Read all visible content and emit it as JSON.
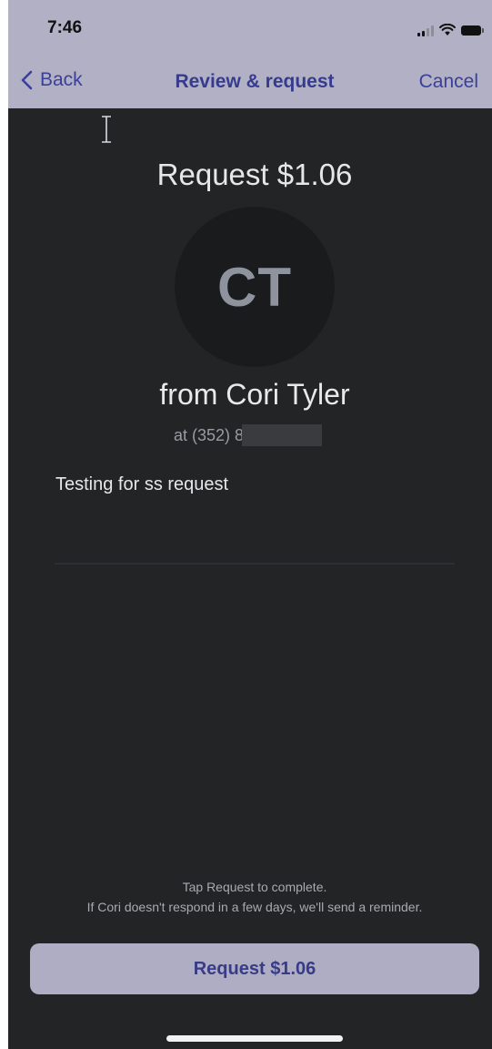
{
  "status_bar": {
    "time": "7:46",
    "icons": [
      "cellular-signal-icon",
      "wifi-icon",
      "battery-icon"
    ]
  },
  "nav": {
    "back_label": "Back",
    "title": "Review & request",
    "cancel_label": "Cancel"
  },
  "request": {
    "title": "Request $1.06",
    "avatar_initials": "CT",
    "recipient_name": "from Cori Tyler",
    "recipient_phone": "at (352) 8",
    "note": "Testing for ss request"
  },
  "footer": {
    "instruction": "Tap Request to complete.",
    "reminder": "If Cori doesn't respond in a few days, we'll send a reminder.",
    "button_label": "Request $1.06"
  },
  "colors": {
    "header_background": "#b1b0c5",
    "screen_background": "#232426",
    "accent_text": "#373b8e",
    "button_background": "#aeadc4"
  }
}
